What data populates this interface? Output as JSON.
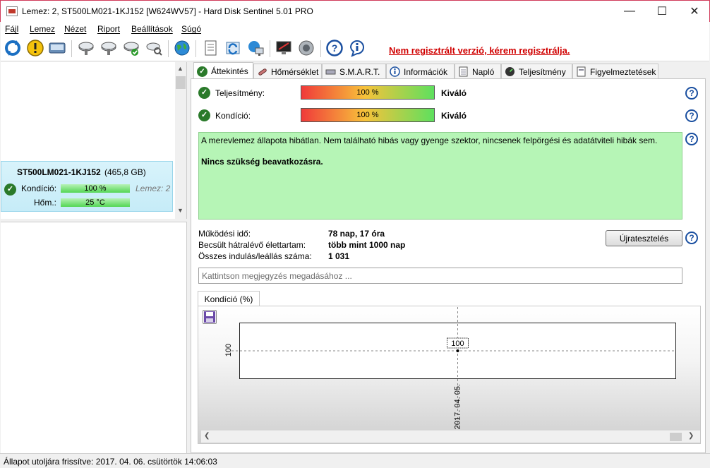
{
  "window": {
    "title": "Lemez: 2, ST500LM021-1KJ152 [W624WV57]  -  Hard Disk Sentinel 5.01 PRO",
    "accent_color": "#d03a5a",
    "controls": [
      "minimize-icon",
      "maximize-icon",
      "close-icon"
    ]
  },
  "menu": {
    "items": [
      "Fájl",
      "Lemez",
      "Nézet",
      "Riport",
      "Beállítások",
      "Súgó"
    ]
  },
  "toolbar": {
    "icons": [
      "refresh-icon",
      "warning-icon",
      "disk-icon",
      "disk-tools-icon",
      "disk-tools-icon",
      "disk-ok-icon",
      "disk-search-icon",
      "globe-icon",
      "report-icon",
      "sync-icon",
      "network-icon",
      "monitor-icon",
      "speaker-icon",
      "help-icon",
      "info-icon"
    ],
    "register_text": "Nem regisztrált verzió, kérem regisztrálja.",
    "register_color": "#d00000"
  },
  "disk_panel": {
    "name": "ST500LM021-1KJ152",
    "size": "(465,8 GB)",
    "condition_label": "Kondíció:",
    "condition_value": "100 %",
    "disk_ref": "Lemez: 2",
    "temp_label": "Hőm.:",
    "temp_value": "25 °C",
    "condition_fraction": 1.0
  },
  "tabs": [
    {
      "label": "Áttekintés",
      "icon": "check-icon",
      "active": true
    },
    {
      "label": "Hőmérséklet",
      "icon": "thermometer-icon",
      "active": false
    },
    {
      "label": "S.M.A.R.T.",
      "icon": "drive-icon",
      "active": false
    },
    {
      "label": "Információk",
      "icon": "info-icon",
      "active": false
    },
    {
      "label": "Napló",
      "icon": "log-icon",
      "active": false
    },
    {
      "label": "Teljesítmény",
      "icon": "gauge-icon",
      "active": false
    },
    {
      "label": "Figyelmeztetések",
      "icon": "alert-icon",
      "active": false
    }
  ],
  "overview": {
    "performance_label": "Teljesítmény:",
    "performance_value": "100 %",
    "performance_fraction": 1.0,
    "performance_status": "Kiváló",
    "condition_label": "Kondíció:",
    "condition_value": "100 %",
    "condition_fraction": 1.0,
    "condition_status": "Kiváló",
    "status_message": "A merevlemez állapota hibátlan. Nem található hibás vagy gyenge szektor, nincsenek felpörgési és adatátviteli hibák sem.",
    "action_message": "Nincs szükség beavatkozásra.",
    "status_bg": "#b6f5b6",
    "uptime_label": "Működési idő:",
    "uptime_value": "78 nap, 17 óra",
    "lifetime_label": "Becsült hátralévő élettartam:",
    "lifetime_value": "több mint 1000 nap",
    "starts_label": "Összes indulás/leállás száma:",
    "starts_value": "1 031",
    "restart_button": "Újratesztelés",
    "note_placeholder": "Kattintson megjegyzés megadásához ..."
  },
  "chart_data": {
    "type": "line",
    "tab_label": "Kondíció  (%)",
    "x": [
      "2017. 04. 05."
    ],
    "series": [
      {
        "values": [
          100
        ]
      }
    ],
    "ytick_labels": [
      "100"
    ],
    "point_labels": [
      "100"
    ]
  },
  "statusbar": {
    "text": "Állapot utoljára frissítve: 2017. 04. 06. csütörtök 14:06:03"
  }
}
